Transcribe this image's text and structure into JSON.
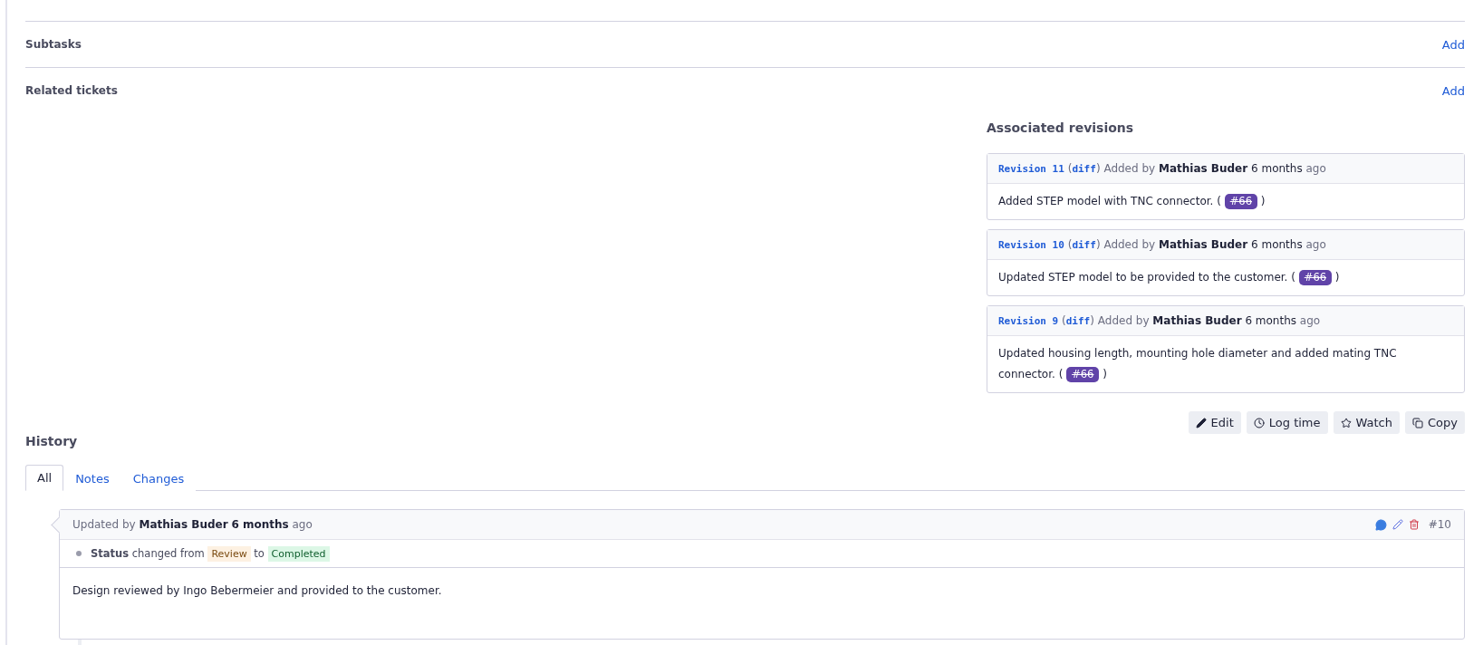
{
  "sections": [
    {
      "title": "Subtasks",
      "action": "Add"
    },
    {
      "title": "Related tickets",
      "action": "Add"
    }
  ],
  "revisions": {
    "title": "Associated revisions",
    "items": [
      {
        "revision": "Revision 11",
        "open": "(",
        "diff": "diff",
        "close": ")",
        "added_by": "Added by",
        "author": "Mathias Buder",
        "age": "6 months",
        "ago": "ago",
        "message": "Added STEP model with TNC connector. (",
        "issue": "#66",
        "issue_closed": true,
        "message_end": ")"
      },
      {
        "revision": "Revision 10",
        "open": "(",
        "diff": "diff",
        "close": ")",
        "added_by": "Added by",
        "author": "Mathias Buder",
        "age": "6 months",
        "ago": "ago",
        "message": "Updated STEP model to be provided to the customer. (",
        "issue": "#66",
        "issue_closed": true,
        "message_end": ")"
      },
      {
        "revision": "Revision 9",
        "open": "(",
        "diff": "diff",
        "close": ")",
        "added_by": "Added by",
        "author": "Mathias Buder",
        "age": "6 months",
        "ago": "ago",
        "message": "Updated housing length, mounting hole diameter and added mating TNC connector. (",
        "issue": "#66",
        "issue_closed": true,
        "message_end": ")"
      }
    ]
  },
  "actions": [
    {
      "kind": "edit",
      "label": "Edit"
    },
    {
      "kind": "time",
      "label": "Log time"
    },
    {
      "kind": "watch",
      "label": "Watch"
    },
    {
      "kind": "copy",
      "label": "Copy"
    }
  ],
  "history": {
    "title": "History",
    "tabs": [
      {
        "label": "All",
        "selected": true
      },
      {
        "label": "Notes",
        "selected": false
      },
      {
        "label": "Changes",
        "selected": false
      }
    ],
    "journals": [
      {
        "header": "Updated by **Mathias Buder** **6 months** ago",
        "number": "#10",
        "details": [
          {
            "field": "Status",
            "changed": "changed from",
            "old": "Review",
            "to": "to",
            "new": "Completed"
          }
        ],
        "note": "Design reviewed by Ingo Bebermeier and provided to the customer."
      }
    ]
  }
}
